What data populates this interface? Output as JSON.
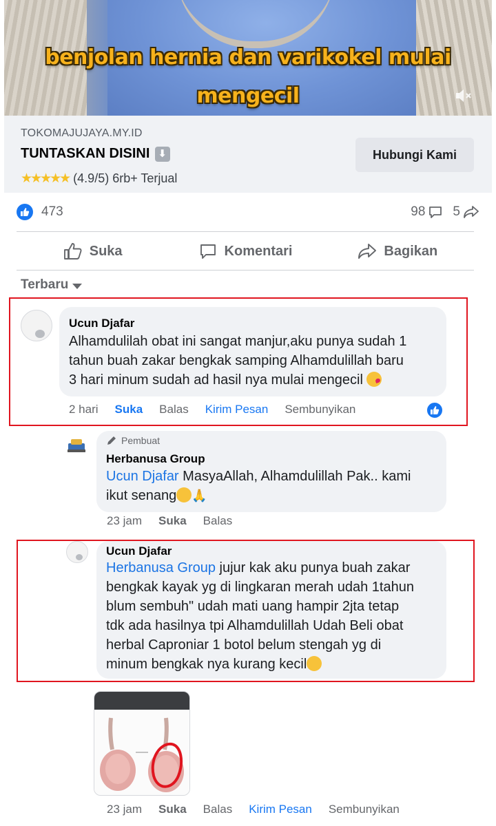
{
  "video": {
    "caption_line1": "benjolan hernia dan varikokel mulai",
    "caption_line2": "mengecil",
    "caption_color": "#f7b21c",
    "mute_icon": "speaker-muted-icon"
  },
  "ad": {
    "domain": "TOKOMAJUJAYA.MY.ID",
    "title": "TUNTASKAN DISINI",
    "title_icon": "down-arrow-icon",
    "stars": "★★★★★",
    "rating_text": "(4.9/5) 6rb+ Terjual",
    "cta_label": "Hubungi Kami"
  },
  "stats": {
    "reactions": "473",
    "comments": "98",
    "shares": "5"
  },
  "actions": {
    "like": "Suka",
    "comment": "Komentari",
    "share": "Bagikan"
  },
  "sort": {
    "label": "Terbaru"
  },
  "comments": [
    {
      "author": "Ucun Djafar",
      "text": "Alhamdulilah obat ini sangat manjur,aku punya sudah 1 tahun buah zakar bengkak samping Alhamdulillah baru 3 hari minum sudah ad hasil nya mulai mengecil",
      "text_lines": [
        "Alhamdulilah obat ini sangat manjur,aku punya sudah 1",
        "tahun buah zakar bengkak samping Alhamdulillah baru",
        "3 hari minum sudah ad hasil nya mulai mengecil"
      ],
      "time": "2 hari",
      "like": "Suka",
      "reply": "Balas",
      "message": "Kirim Pesan",
      "hide": "Sembunyikan"
    },
    {
      "badge": "Pembuat",
      "author": "Herbanusa Group",
      "mention": "Ucun Djafar",
      "text_line1": "MasyaAllah, Alhamdulillah Pak.. kami",
      "text_line2": "ikut senang",
      "time": "23 jam",
      "like": "Suka",
      "reply": "Balas"
    },
    {
      "author": "Ucun Djafar",
      "mention": "Herbanusa Group",
      "text_lines": [
        "jujur kak aku punya buah zakar",
        "bengkak kayak yg di lingkaran merah udah 1tahun",
        "blum sembuh\" udah mati uang hampir 2jta tetap",
        "tdk ada hasilnya tpi Alhamdulillah Udah Beli obat",
        "herbal Caproniar 1 botol belum stengah yg di",
        "minum bengkak nya kurang kecil"
      ],
      "time": "23 jam",
      "like": "Suka",
      "reply": "Balas",
      "message": "Kirim Pesan",
      "hide": "Sembunyikan"
    }
  ],
  "colors": {
    "facebook_blue": "#1877f2",
    "highlight_red": "#e0151f",
    "bubble_bg": "#f0f2f5"
  }
}
